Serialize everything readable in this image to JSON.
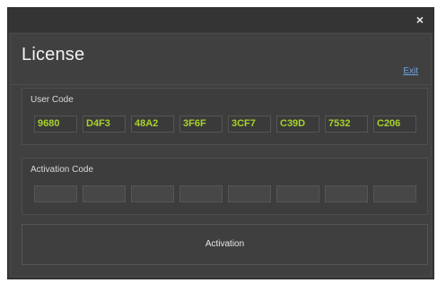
{
  "window": {
    "close_glyph": "×"
  },
  "header": {
    "title": "License",
    "exit_label": "Exit"
  },
  "user_code": {
    "label": "User Code",
    "segments": [
      "9680",
      "D4F3",
      "48A2",
      "3F6F",
      "3CF7",
      "C39D",
      "7532",
      "C206"
    ]
  },
  "activation_code": {
    "label": "Activation Code",
    "segments": [
      "",
      "",
      "",
      "",
      "",
      "",
      "",
      ""
    ]
  },
  "actions": {
    "activation_label": "Activation"
  },
  "colors": {
    "background": "#3c3c3c",
    "code_text": "#a6d12c",
    "link": "#6fa2e6"
  }
}
